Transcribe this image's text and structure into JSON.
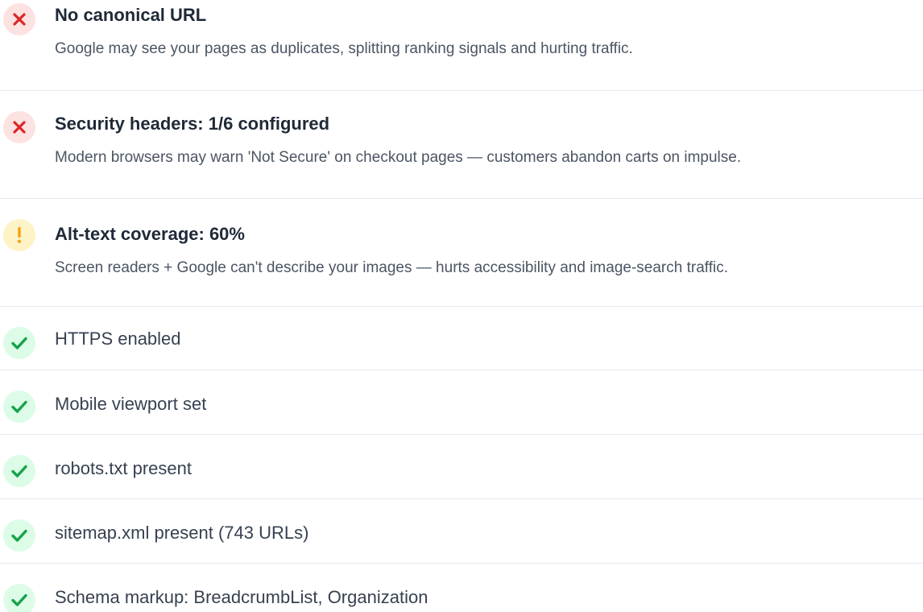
{
  "colors": {
    "fail": "#dc2626",
    "fail_bg": "#fde2e2",
    "warn": "#f59e0b",
    "warn_bg": "#fef3c7",
    "pass": "#16a34a",
    "pass_bg": "#dcfce7"
  },
  "issues": [
    {
      "status": "fail",
      "icon": "x-icon",
      "title": "No canonical URL",
      "description": "Google may see your pages as duplicates, splitting ranking signals and hurting traffic."
    },
    {
      "status": "fail",
      "icon": "x-icon",
      "title": "Security headers: 1/6 configured",
      "description": "Modern browsers may warn 'Not Secure' on checkout pages — customers abandon carts on impulse."
    },
    {
      "status": "warn",
      "icon": "exclamation-icon",
      "title": "Alt-text coverage: 60%",
      "description": "Screen readers + Google can't describe your images — hurts accessibility and image-search traffic."
    }
  ],
  "passed": [
    {
      "status": "pass",
      "icon": "check-icon",
      "label": "HTTPS enabled"
    },
    {
      "status": "pass",
      "icon": "check-icon",
      "label": "Mobile viewport set"
    },
    {
      "status": "pass",
      "icon": "check-icon",
      "label": "robots.txt present"
    },
    {
      "status": "pass",
      "icon": "check-icon",
      "label": "sitemap.xml present (743 URLs)"
    },
    {
      "status": "pass",
      "icon": "check-icon",
      "label": "Schema markup: BreadcrumbList, Organization"
    }
  ]
}
